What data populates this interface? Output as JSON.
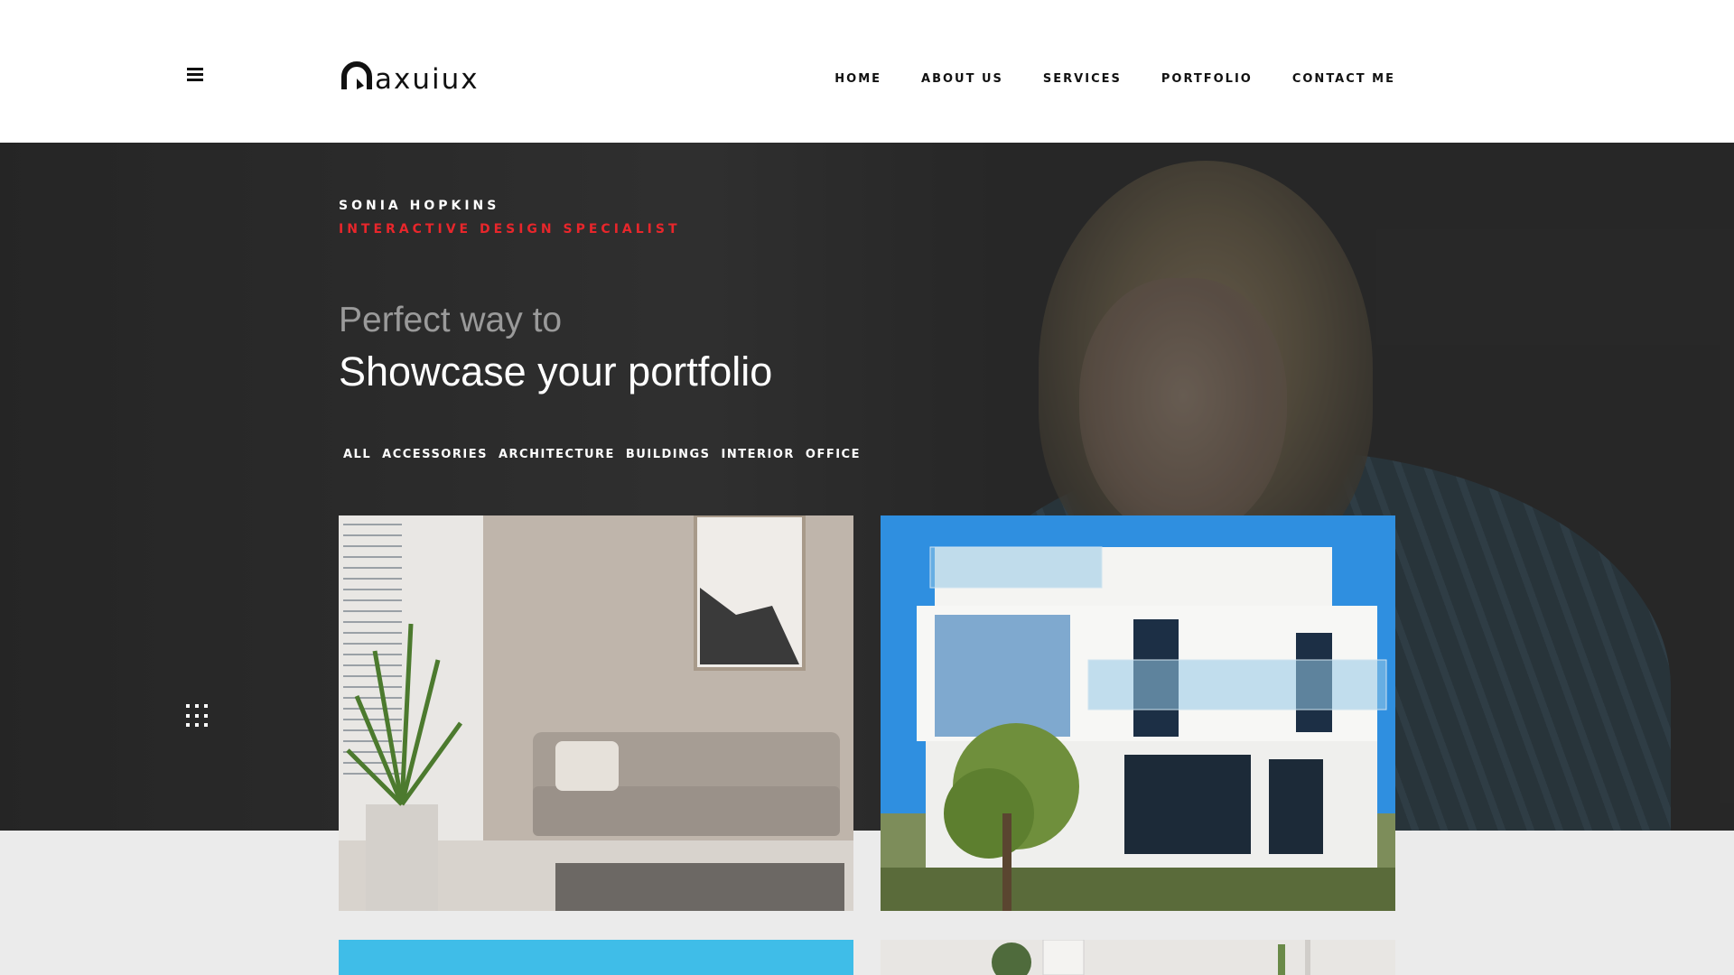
{
  "brand": {
    "logo_text": "axuiux",
    "logo_icon": "logo-m-icon"
  },
  "nav": {
    "items": [
      "HOME",
      "ABOUT US",
      "SERVICES",
      "PORTFOLIO",
      "CONTACT ME"
    ]
  },
  "hero": {
    "name": "SONIA HOPKINS",
    "role": "INTERACTIVE DESIGN SPECIALIST",
    "line1": "Perfect way to",
    "line2": "Showcase your portfolio"
  },
  "filters": [
    "ALL",
    "ACCESSORIES",
    "ARCHITECTURE",
    "BUILDINGS",
    "INTERIOR",
    "OFFICE"
  ],
  "colors": {
    "accent": "#e8262b",
    "header_bg": "#ffffff",
    "hero_bg": "#2d2d2d",
    "page_bg": "#ebebeb"
  },
  "icons": {
    "menu": "hamburger-icon",
    "grid": "grid-dots-icon"
  },
  "portfolio": [
    {
      "image": "living-room-sofa-photo"
    },
    {
      "image": "white-villa-photo"
    },
    {
      "image": "blue-sky-photo"
    },
    {
      "image": "interior-shelf-photo"
    }
  ]
}
